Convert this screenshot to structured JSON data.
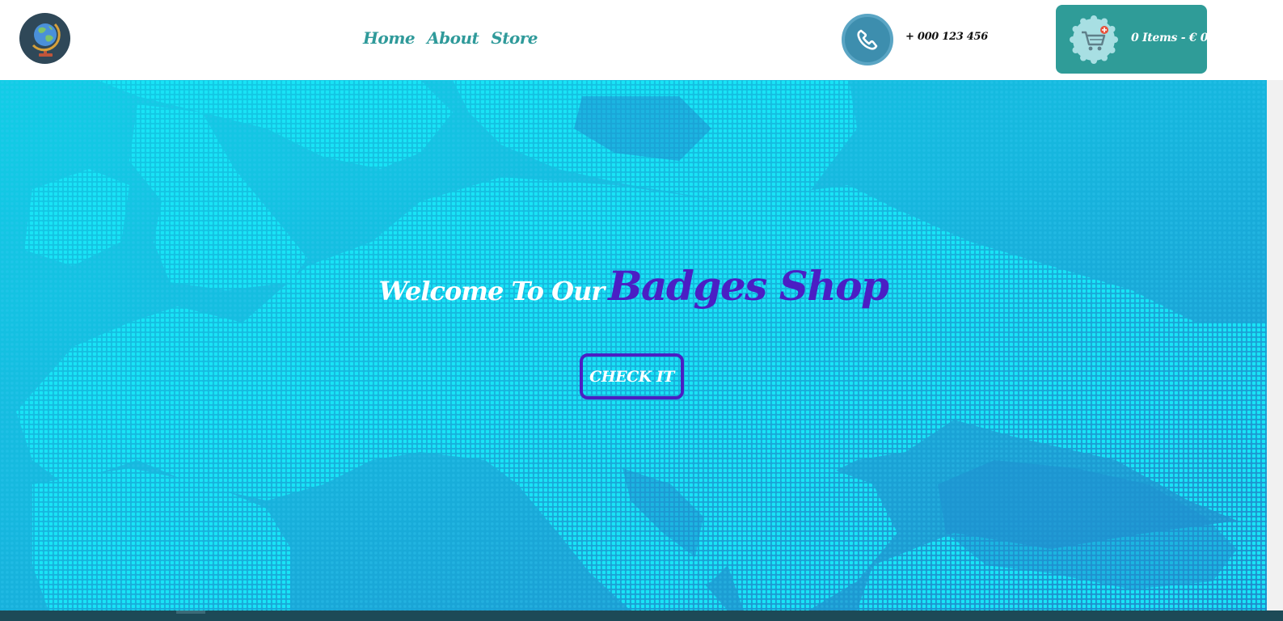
{
  "nav": {
    "items": [
      {
        "label": "Home"
      },
      {
        "label": "About"
      },
      {
        "label": "Store"
      }
    ]
  },
  "contact": {
    "phone": "+ 000 123 456",
    "icon": "phone-icon"
  },
  "cart": {
    "label": "0 Items - € 0",
    "icon": "shopping-cart-icon"
  },
  "logo": {
    "icon": "globe-icon"
  },
  "hero": {
    "welcome": "Welcome To Our",
    "brand": "Badges Shop",
    "cta_label": "CHECK IT"
  },
  "colors": {
    "accent_teal": "#2f9c98",
    "brand_purple": "#4b1ec4",
    "hero_cyan": "#12cde6",
    "logo_navy": "#2f4858"
  }
}
